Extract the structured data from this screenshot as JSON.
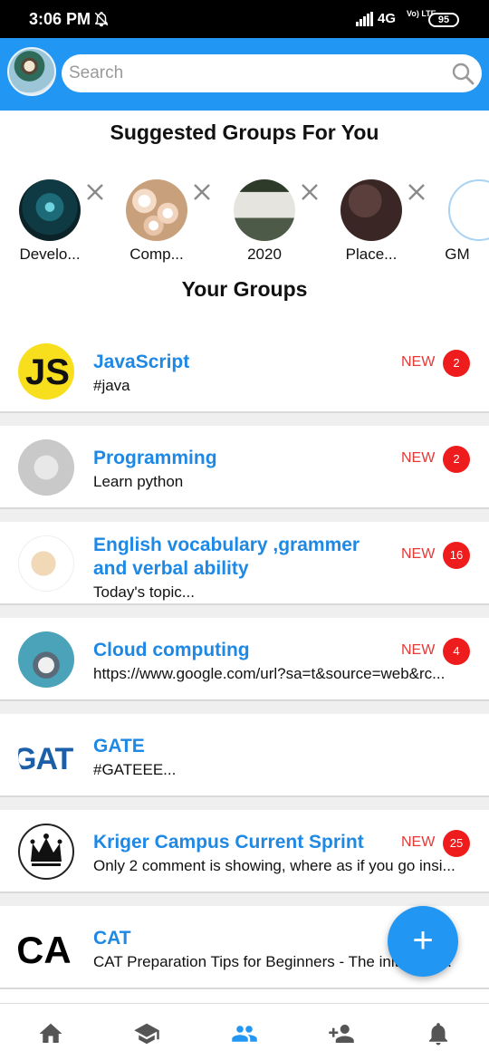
{
  "status_bar": {
    "time": "3:06 PM",
    "network": "4G",
    "volte": "Vo) LTE",
    "battery": "95"
  },
  "search": {
    "placeholder": "Search"
  },
  "suggested": {
    "title": "Suggested Groups For You",
    "items": [
      {
        "label": "Develo..."
      },
      {
        "label": "Comp..."
      },
      {
        "label": "2020"
      },
      {
        "label": "Place..."
      },
      {
        "label": "GM"
      }
    ]
  },
  "your_groups": {
    "title": "Your Groups",
    "items": [
      {
        "title": "JavaScript",
        "subtitle": "#java",
        "new": "NEW",
        "count": "2"
      },
      {
        "title": "Programming",
        "subtitle": "Learn python",
        "new": "NEW",
        "count": "2"
      },
      {
        "title": "English vocabulary ,grammer and verbal ability",
        "subtitle": "Today's  topic...",
        "new": "NEW",
        "count": "16"
      },
      {
        "title": "Cloud computing",
        "subtitle": "https://www.google.com/url?sa=t&source=web&rc...",
        "new": "NEW",
        "count": "4"
      },
      {
        "title": "GATE",
        "subtitle": "#GATEEE..."
      },
      {
        "title": "Kriger Campus Current Sprint",
        "subtitle": "Only 2 comment is showing, where as if you go insi...",
        "new": "NEW",
        "count": "25"
      },
      {
        "title": "CAT",
        "subtitle": "CAT Preparation Tips for Beginners - The initial ste..."
      }
    ]
  },
  "avatar_text": {
    "js": "JS",
    "gate": "GATE",
    "cat": "CA"
  },
  "fab": {
    "label": "+"
  },
  "colors": {
    "primary": "#2196f3",
    "title_blue": "#1e88e5",
    "new_red": "#e53935",
    "badge_red": "#ee1c1c"
  },
  "nav": {
    "icons": [
      "home-icon",
      "school-icon",
      "groups-icon",
      "person-add-icon",
      "bell-icon"
    ],
    "active": "groups-icon"
  }
}
